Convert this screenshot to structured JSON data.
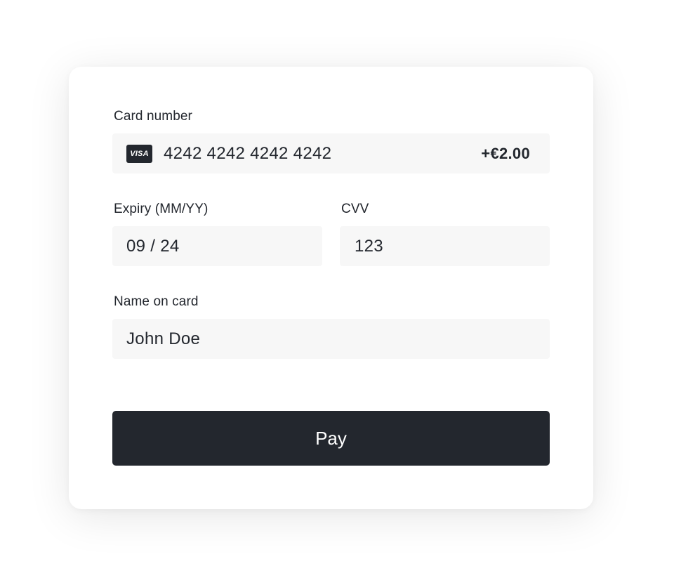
{
  "form": {
    "card_number_label": "Card number",
    "card_number_value": "4242 4242 4242 4242",
    "card_brand": "VISA",
    "fee": "+€2.00",
    "expiry_label": "Expiry (MM/YY)",
    "expiry_value": "09 / 24",
    "cvv_label": "CVV",
    "cvv_value": "123",
    "name_label": "Name on card",
    "name_value": "John Doe",
    "pay_label": "Pay"
  },
  "colors": {
    "primary": "#23272e",
    "field_background": "#f7f7f7",
    "card_background": "#ffffff"
  }
}
